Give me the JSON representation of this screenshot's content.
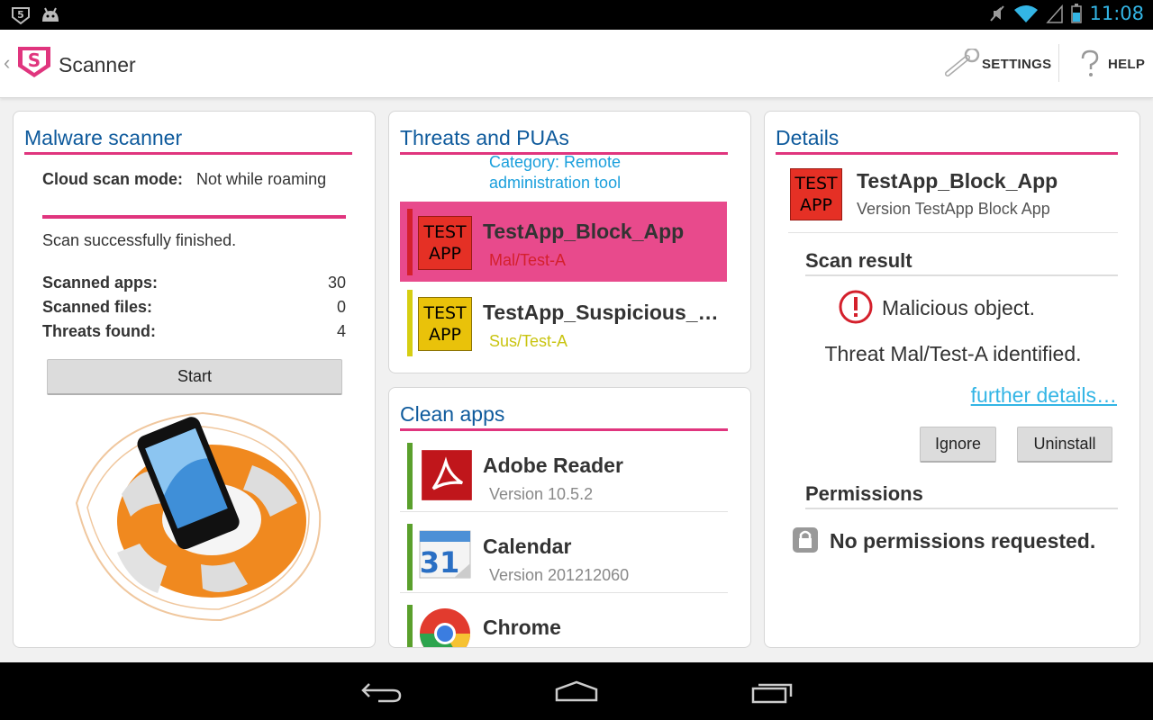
{
  "status_bar": {
    "time": "11:08"
  },
  "action_bar": {
    "title": "Scanner",
    "settings": "SETTINGS",
    "help": "HELP"
  },
  "malware_scanner": {
    "heading": "Malware scanner",
    "cloud_label": "Cloud scan mode:",
    "cloud_value": "Not while roaming",
    "progress": 1.0,
    "status": "Scan successfully finished.",
    "stats": [
      {
        "label": "Scanned apps:",
        "value": "30"
      },
      {
        "label": "Scanned files:",
        "value": "0"
      },
      {
        "label": "Threats found:",
        "value": "4"
      }
    ],
    "start_label": "Start"
  },
  "threats": {
    "heading": "Threats and PUAs",
    "category": "Category: Remote administration tool",
    "items": [
      {
        "name": "TestApp_Block_App",
        "detail": "Mal/Test-A",
        "icon": "TEST APP",
        "color": "#e84a8c",
        "bar": "#d4202c",
        "detail_color": "#d4202c"
      },
      {
        "name": "TestApp_Suspicious_A…",
        "detail": "Sus/Test-A",
        "icon": "TEST APP",
        "color": "#ffffff",
        "bar": "#d6ce12",
        "detail_color": "#c9c410"
      }
    ]
  },
  "clean_apps": {
    "heading": "Clean apps",
    "items": [
      {
        "name": "Adobe Reader",
        "version": "Version 10.5.2",
        "icon": "adobe-reader-icon"
      },
      {
        "name": "Calendar",
        "version": "Version 201212060",
        "icon": "calendar-icon",
        "day": "31"
      },
      {
        "name": "Chrome",
        "version": "",
        "icon": "chrome-icon"
      }
    ],
    "bar_color": "#5aa02c"
  },
  "details": {
    "heading": "Details",
    "app_name": "TestApp_Block_App",
    "app_version": "Version TestApp Block App",
    "icon": "TEST APP",
    "scan_result_heading": "Scan result",
    "result": "Malicious object.",
    "threat": "Threat Mal/Test-A identified.",
    "further": "further details…",
    "ignore_label": "Ignore",
    "uninstall_label": "Uninstall",
    "permissions_heading": "Permissions",
    "permissions_text": "No permissions requested."
  },
  "colors": {
    "accent": "#e0357e",
    "heading": "#0e5a9c",
    "link": "#33b5e5"
  }
}
